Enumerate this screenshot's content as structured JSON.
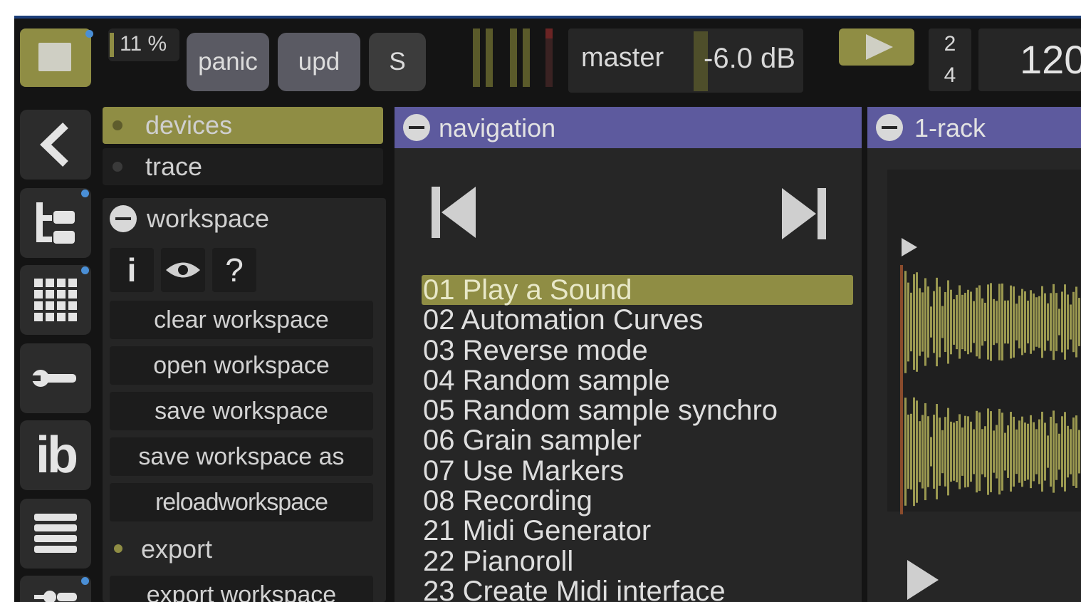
{
  "topbar": {
    "cpu": "11 %",
    "panic_label": "panic",
    "upd_label": "upd",
    "s_label": "S",
    "master_label": "master",
    "master_value": "-6.0 dB",
    "time_sig_top": "2",
    "time_sig_bottom": "4",
    "tempo": "120"
  },
  "tabs": {
    "devices": "devices",
    "trace": "trace"
  },
  "workspace": {
    "title": "workspace",
    "info_symbol": "i",
    "help_symbol": "?",
    "buttons": [
      "clear workspace",
      "open workspace",
      "save workspace",
      "save workspace as",
      "reloadworkspace"
    ],
    "export_label": "export",
    "export_button": "export workspace"
  },
  "navigation": {
    "title": "navigation",
    "tracks": [
      "01 Play a Sound",
      "02 Automation Curves",
      "03 Reverse mode",
      "04 Random sample",
      "05 Random sample synchro",
      "06 Grain sampler",
      "07 Use Markers",
      "08 Recording",
      "21 Midi Generator",
      "22 Pianoroll",
      "23 Create Midi interface"
    ],
    "selected_index": 0
  },
  "rack": {
    "title": "1-rack"
  },
  "colors": {
    "accent": "#8f8d44",
    "panel_header": "#5d5a9e",
    "background": "#141414",
    "indicator": "#4a8fd6"
  },
  "icons": [
    "stop-icon",
    "play-icon",
    "back-icon",
    "tree-icon",
    "grid-icon",
    "wrench-icon",
    "ib-icon",
    "list-icon",
    "plugin-icon",
    "info-icon",
    "eye-icon",
    "help-icon",
    "prev-icon",
    "next-icon",
    "collapse-icon"
  ]
}
